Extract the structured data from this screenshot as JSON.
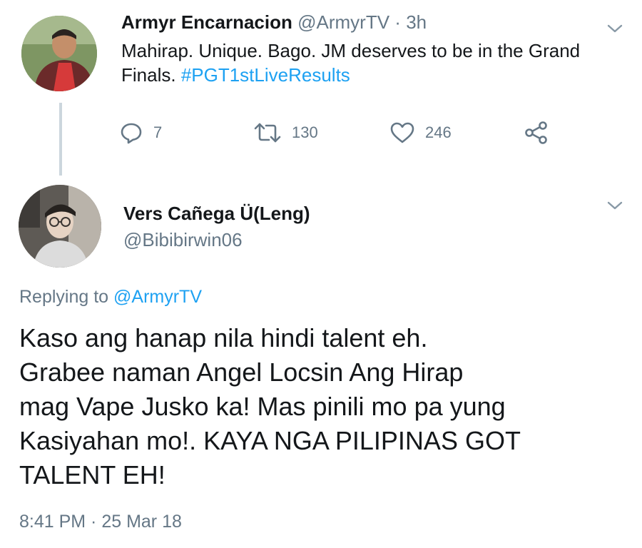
{
  "parent_tweet": {
    "author_name": "Armyr Encarnacion",
    "author_handle": "@ArmyrTV",
    "separator": "·",
    "time_ago": "3h",
    "text_lines": [
      "Mahirap. Unique. Bago. JM deserves to be in the Grand",
      "Finals."
    ],
    "hashtag": "#PGT1stLiveResults",
    "reply_count": "7",
    "retweet_count": "130",
    "like_count": "246",
    "icons": {
      "reply": "reply-icon",
      "retweet": "retweet-icon",
      "like": "heart-icon",
      "share": "share-icon",
      "menu": "chevron-down-icon"
    }
  },
  "reply_tweet": {
    "author_name": "Vers Cañega Ü(Leng)",
    "author_handle": "@Bibibirwin06",
    "replying_prefix": "Replying to",
    "replying_to": "@ArmyrTV",
    "body_lines": [
      "Kaso ang hanap nila hindi talent eh.",
      "Grabee naman Angel Locsin Ang Hirap",
      "mag Vape Jusko ka! Mas pinili mo pa yung",
      "Kasiyahan mo!. KAYA NGA PILIPINAS GOT",
      "TALENT EH!"
    ],
    "timestamp": "8:41 PM · 25 Mar 18"
  },
  "colors": {
    "accent": "#1da1f2",
    "secondary_text": "#657786",
    "primary_text": "#14171a",
    "thread_line": "#ccd6dd",
    "background": "#ffffff"
  }
}
